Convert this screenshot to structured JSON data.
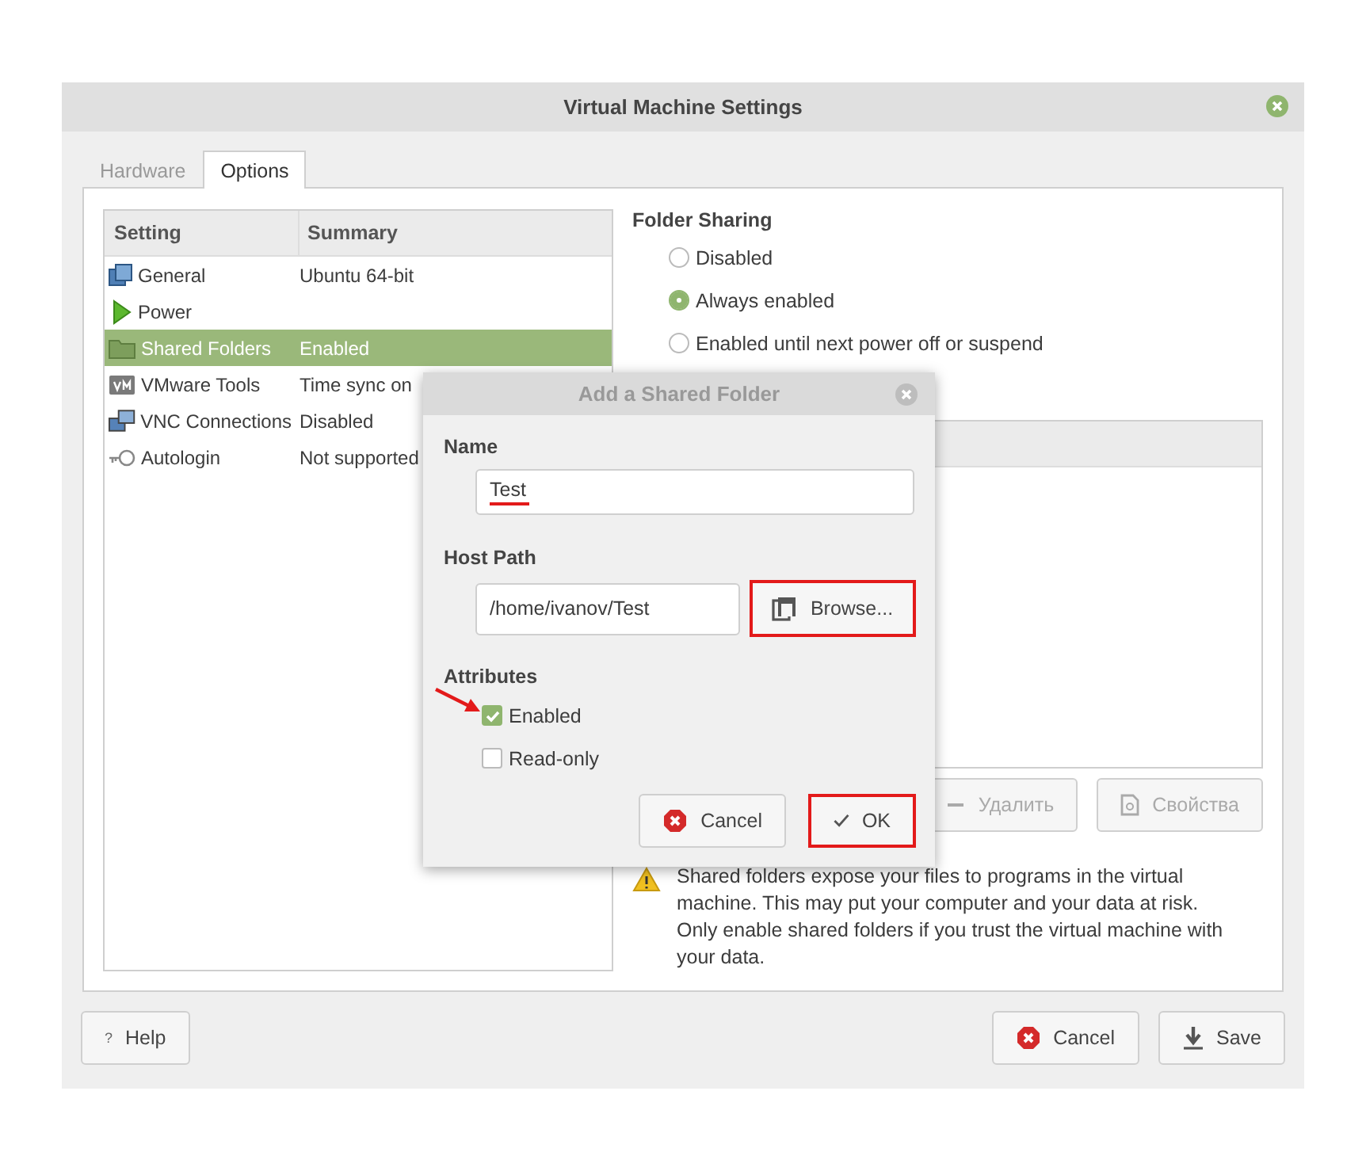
{
  "window": {
    "title": "Virtual Machine Settings"
  },
  "tabs": [
    {
      "label": "Hardware",
      "selected": false
    },
    {
      "label": "Options",
      "selected": true
    }
  ],
  "settings_table": {
    "columns": [
      "Setting",
      "Summary"
    ],
    "rows": [
      {
        "kind": "general",
        "setting": "General",
        "summary": "Ubuntu 64-bit",
        "selected": false
      },
      {
        "kind": "power",
        "setting": "Power",
        "selected": false
      },
      {
        "kind": "folder",
        "setting": "Shared Folders",
        "summary": "Enabled",
        "selected": true
      },
      {
        "kind": "tools",
        "setting": "VMware Tools",
        "summary": "Time sync on",
        "selected": false
      },
      {
        "kind": "vnc",
        "setting": "VNC Connections",
        "summary": "Disabled",
        "selected": false
      },
      {
        "kind": "autologin",
        "setting": "Autologin",
        "summary": "Not supported",
        "selected": false
      }
    ]
  },
  "folder_sharing": {
    "title": "Folder Sharing",
    "options": [
      {
        "label": "Disabled",
        "selected": false
      },
      {
        "label": "Always enabled",
        "selected": true
      },
      {
        "label": "Enabled until next power off or suspend",
        "selected": false
      }
    ]
  },
  "folder_buttons": [
    {
      "kind": "remove",
      "label": "Удалить",
      "disabled": true
    },
    {
      "kind": "properties",
      "label": "Свойства",
      "disabled": true
    }
  ],
  "warning": "Shared folders expose your files to programs in the virtual machine. This may put your computer and your data at risk. Only enable shared folders if you trust the virtual machine with your data.",
  "dialog": {
    "title": "Add a Shared Folder",
    "name_label": "Name",
    "name_value": "Test",
    "name_underlined": true,
    "host_path_label": "Host Path",
    "host_path_value": "/home/ivanov/Test",
    "browse_button": {
      "label": "Browse...",
      "highlighted": true
    },
    "attributes_label": "Attributes",
    "attributes": [
      {
        "label": "Enabled",
        "checked": true,
        "pointed": true
      },
      {
        "label": "Read-only",
        "checked": false,
        "pointed": false
      }
    ],
    "buttons": [
      {
        "kind": "cancel",
        "label": "Cancel",
        "highlighted": false
      },
      {
        "kind": "ok",
        "label": "OK",
        "highlighted": true
      }
    ]
  },
  "footer_buttons": [
    {
      "kind": "help",
      "label": "Help",
      "icon": "?"
    },
    {
      "kind": "cancel",
      "label": "Cancel"
    },
    {
      "kind": "save",
      "label": "Save"
    }
  ]
}
